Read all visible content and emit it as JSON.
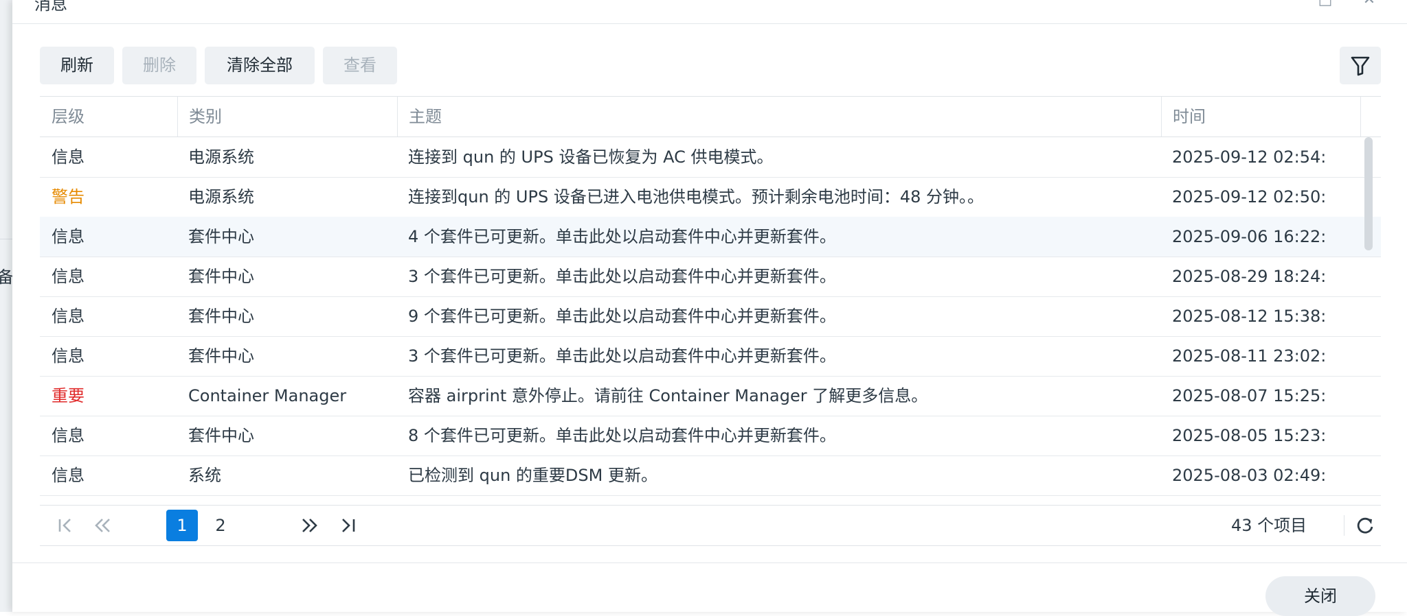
{
  "background": {
    "partial_char": "备"
  },
  "window": {
    "title": "消息",
    "maximize_glyph": "□",
    "close_glyph": "✕"
  },
  "toolbar": {
    "refresh_label": "刷新",
    "delete_label": "删除",
    "clear_all_label": "清除全部",
    "view_label": "查看"
  },
  "table": {
    "columns": [
      "层级",
      "类别",
      "主题",
      "时间"
    ],
    "rows": [
      {
        "level": "信息",
        "category": "电源系统",
        "subject": "连接到 qun 的 UPS 设备已恢复为 AC 供电模式。",
        "time": "2025-09-12 02:54:"
      },
      {
        "level": "警告",
        "category": "电源系统",
        "subject": "连接到qun 的 UPS 设备已进入电池供电模式。预计剩余电池时间：48 分钟。。",
        "time": "2025-09-12 02:50:"
      },
      {
        "level": "信息",
        "category": "套件中心",
        "subject": "4 个套件已可更新。单击此处以启动套件中心并更新套件。",
        "time": "2025-09-06 16:22:"
      },
      {
        "level": "信息",
        "category": "套件中心",
        "subject": "3 个套件已可更新。单击此处以启动套件中心并更新套件。",
        "time": "2025-08-29 18:24:"
      },
      {
        "level": "信息",
        "category": "套件中心",
        "subject": "9 个套件已可更新。单击此处以启动套件中心并更新套件。",
        "time": "2025-08-12 15:38:"
      },
      {
        "level": "信息",
        "category": "套件中心",
        "subject": "3 个套件已可更新。单击此处以启动套件中心并更新套件。",
        "time": "2025-08-11 23:02:"
      },
      {
        "level": "重要",
        "category": "Container Manager",
        "subject": "容器 airprint 意外停止。请前往 Container Manager 了解更多信息。",
        "time": "2025-08-07 15:25:"
      },
      {
        "level": "信息",
        "category": "套件中心",
        "subject": "8 个套件已可更新。单击此处以启动套件中心并更新套件。",
        "time": "2025-08-05 15:23:"
      },
      {
        "level": "信息",
        "category": "系统",
        "subject": "已检测到 qun 的重要DSM 更新。",
        "time": "2025-08-03 02:49:"
      }
    ]
  },
  "pager": {
    "pages": [
      "1",
      "2"
    ],
    "current_page": "1",
    "item_count": "43 个项目"
  },
  "footer": {
    "close_label": "关闭"
  },
  "colors": {
    "level_info": "#2d3a45",
    "level_warning": "#e68a00",
    "level_critical": "#e02a2a",
    "accent": "#0a7ee0"
  }
}
